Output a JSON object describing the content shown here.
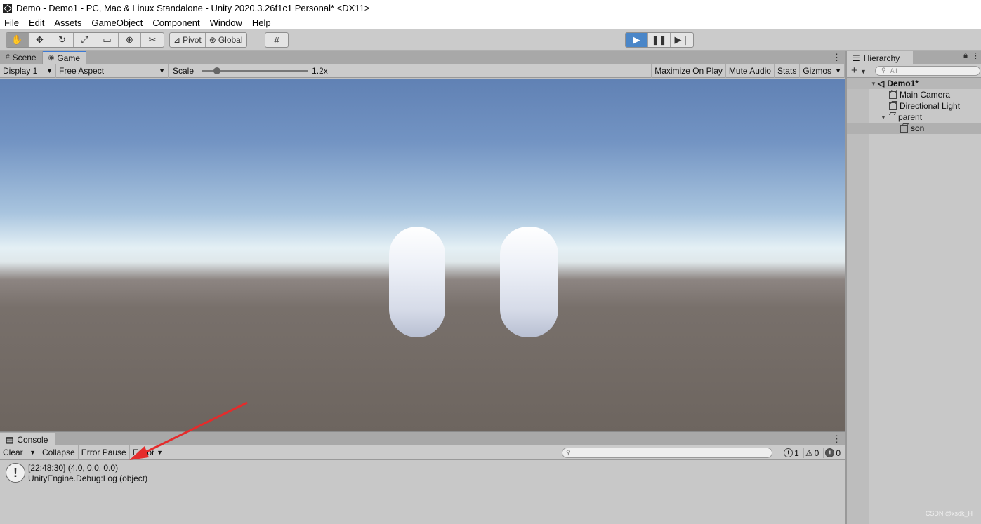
{
  "window": {
    "title": "Demo - Demo1 - PC, Mac & Linux Standalone - Unity 2020.3.26f1c1 Personal* <DX11>"
  },
  "menu": [
    "File",
    "Edit",
    "Assets",
    "GameObject",
    "Component",
    "Window",
    "Help"
  ],
  "toolbar": {
    "pivot_label": "Pivot",
    "global_label": "Global"
  },
  "tabs": {
    "scene": "Scene",
    "game": "Game"
  },
  "game_toolbar": {
    "display": "Display 1",
    "aspect": "Free Aspect",
    "scale_label": "Scale",
    "scale_value": "1.2x",
    "maximize": "Maximize On Play",
    "mute": "Mute Audio",
    "stats": "Stats",
    "gizmos": "Gizmos"
  },
  "console": {
    "tab": "Console",
    "clear": "Clear",
    "collapse": "Collapse",
    "error_pause": "Error Pause",
    "editor": "Editor",
    "counts": {
      "log": "1",
      "warn": "0",
      "error": "0"
    },
    "entry": {
      "line1": "[22:48:30] (4.0, 0.0, 0.0)",
      "line2": "UnityEngine.Debug:Log (object)"
    }
  },
  "hierarchy": {
    "tab": "Hierarchy",
    "search_placeholder": "All",
    "scene": "Demo1*",
    "items": [
      "Main Camera",
      "Directional Light",
      "parent",
      "son"
    ]
  },
  "watermark": "CSDN @xsdk_H"
}
